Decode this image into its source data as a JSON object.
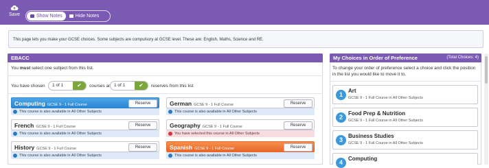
{
  "toolbar": {
    "save_label": "Save",
    "show_notes": "Show Notes",
    "hide_notes": "Hide Notes"
  },
  "info_text": "This page lets you make your GCSE choices.  Some subjects are compulsory at GCSE level.  These are:  English, Maths, Science and RE.",
  "ebacc": {
    "title": "EBACC",
    "instruction_pre": "You ",
    "instruction_bold": "must",
    "instruction_post": " select one subject from this list.",
    "chosen_pre": "You have chosen",
    "chosen_count": "1 of 1",
    "chosen_mid": "courses and",
    "reserve_count": "1 of 1",
    "chosen_post": "reserves from this list",
    "subjects": [
      {
        "name": "Computing",
        "detail": "GCSE 9 - 1 Full Course",
        "button": "Reserve",
        "note": "This course is also available in All Other Subjects",
        "state": "selected-blue"
      },
      {
        "name": "German",
        "detail": "GCSE 9 - 1 Full Course",
        "button": "Reserve",
        "note": "This course is also available in All Other Subjects",
        "state": "none"
      },
      {
        "name": "French",
        "detail": "GCSE 9 - 1 Full Course",
        "button": "Reserve",
        "note": "This course is also available in All Other Subjects",
        "state": "none"
      },
      {
        "name": "Geography",
        "detail": "GCSE 9 - 1 Full Course",
        "button": "Reserve",
        "note": "You have selected this course in All Other Subjects",
        "state": "warning"
      },
      {
        "name": "History",
        "detail": "GCSE 9 - 1 Full Course",
        "button": "Reserve",
        "note": "This course is also available in All Other Subjects",
        "state": "none"
      },
      {
        "name": "Spanish",
        "detail": "GCSE 9 - 1 Full Course",
        "button": "Reserve",
        "note": "This course is also available in All Other Subjects",
        "state": "selected-orange"
      }
    ]
  },
  "choices": {
    "title": "My Choices in Order of Preference",
    "total": "(Total Choices: 4)",
    "instruction": "To change your order of preference select a choice and click the position in the list you would like to move it to.",
    "items": [
      {
        "rank": "1",
        "name": "Art",
        "detail": "GCSE 9 - 1 Full Course in All Other Subjects"
      },
      {
        "rank": "2",
        "name": "Food Prep & Nutrition",
        "detail": "GCSE 9 - 1 Full Course in All Other Subjects"
      },
      {
        "rank": "3",
        "name": "Business Studies",
        "detail": "GCSE 9 - 1 Full Course in All Other Subjects"
      },
      {
        "rank": "4",
        "name": "Computing",
        "detail": ""
      }
    ]
  },
  "colors": {
    "brand_purple": "#7b5ab3",
    "selected_blue": "#2a84d0",
    "selected_orange": "#e8672a",
    "check_green": "#7aa63a",
    "rank_badge": "#3a98dd"
  }
}
